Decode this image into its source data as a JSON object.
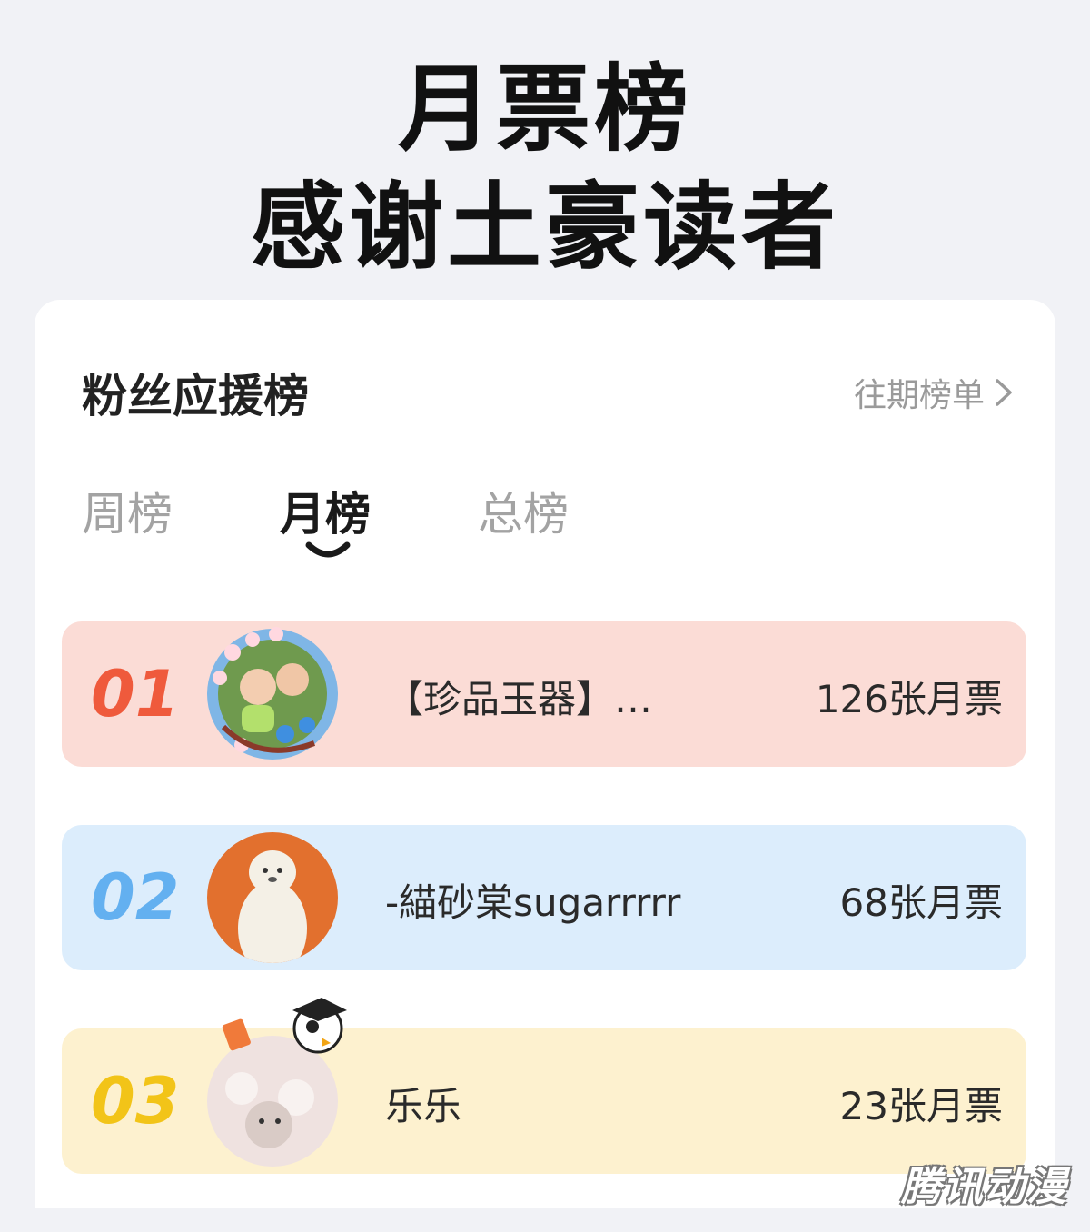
{
  "headline": {
    "line1": "月票榜",
    "line2": "感谢土豪读者"
  },
  "card": {
    "title": "粉丝应援榜",
    "history_label": "往期榜单"
  },
  "tabs": [
    {
      "label": "周榜",
      "active": false
    },
    {
      "label": "月榜",
      "active": true
    },
    {
      "label": "总榜",
      "active": false
    }
  ],
  "ranking": [
    {
      "rank": "01",
      "name": "【珍品玉器】…",
      "votes": "126张月票",
      "rank_color": "#ef5a3c",
      "row_color": "#fbdcd6"
    },
    {
      "rank": "02",
      "name": "-緢砂棠sugarrrrr",
      "votes": "68张月票",
      "rank_color": "#63b0f0",
      "row_color": "#dcedfc"
    },
    {
      "rank": "03",
      "name": "乐乐",
      "votes": "23张月票",
      "rank_color": "#f2c418",
      "row_color": "#fdf1cf"
    }
  ],
  "icons": {
    "history_arrow": "chevron-right-icon",
    "tab_indicator": "smile-underline-icon"
  },
  "watermark": "腾讯动漫"
}
